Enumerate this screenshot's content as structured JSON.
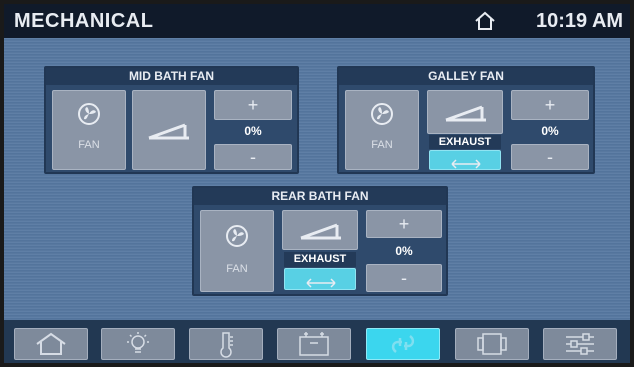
{
  "header": {
    "title": "MECHANICAL",
    "time": "10:19 AM",
    "home_icon": "home-icon"
  },
  "colors": {
    "background": "#5577a0",
    "panel": "#2f4a6c",
    "button": "#8a95a6",
    "active": "#3bd6ee",
    "header": "#101a2a"
  },
  "panels": {
    "mid_bath": {
      "title": "MID BATH FAN",
      "fan_label": "FAN",
      "plus": "+",
      "minus": "-",
      "speed": "0%"
    },
    "galley": {
      "title": "GALLEY FAN",
      "fan_label": "FAN",
      "plus": "+",
      "minus": "-",
      "speed": "0%",
      "mode_label": "EXHAUST"
    },
    "rear_bath": {
      "title": "REAR BATH FAN",
      "fan_label": "FAN",
      "plus": "+",
      "minus": "-",
      "speed": "0%",
      "mode_label": "EXHAUST"
    }
  },
  "nav": {
    "items": [
      {
        "icon": "home-icon"
      },
      {
        "icon": "lightbulb-icon"
      },
      {
        "icon": "thermometer-icon"
      },
      {
        "icon": "battery-icon"
      },
      {
        "icon": "fan-vent-icon",
        "active": true
      },
      {
        "icon": "slide-out-icon"
      },
      {
        "icon": "settings-sliders-icon"
      }
    ]
  }
}
